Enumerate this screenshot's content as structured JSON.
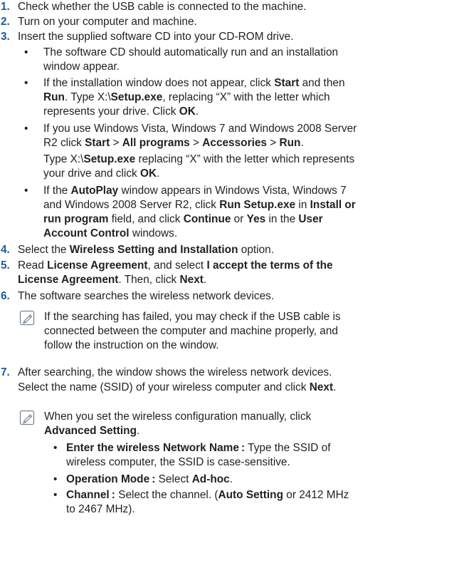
{
  "steps": [
    {
      "num": "1.",
      "lines": [
        [
          "Check whether the USB cable is connected to the machine."
        ]
      ]
    },
    {
      "num": "2.",
      "lines": [
        [
          "Turn on your computer and machine."
        ]
      ]
    },
    {
      "num": "3.",
      "lines": [
        [
          "Insert the supplied software CD into your CD-ROM drive."
        ]
      ]
    },
    {
      "num": "4.",
      "lines": [
        [
          "Select the ",
          "Wireless Setting and Installation",
          " option."
        ]
      ]
    },
    {
      "num": "5.",
      "lines": [
        [
          "Read ",
          "License Agreement",
          ", and select ",
          "I accept the terms of the"
        ],
        [
          "",
          "License Agreement",
          ". Then, click ",
          "Next",
          "."
        ]
      ]
    },
    {
      "num": "6.",
      "lines": [
        [
          "The software searches the wireless network devices."
        ]
      ]
    },
    {
      "num": "7.",
      "lines": [
        [
          "After searching, the window shows the wireless network devices."
        ],
        [
          "Select the name (SSID) of your wireless computer and click ",
          "Next",
          "."
        ]
      ]
    }
  ],
  "step3_bullets": [
    {
      "lines": [
        [
          "The software CD should automatically run and an installation"
        ],
        [
          "window appear."
        ]
      ]
    },
    {
      "lines": [
        [
          "If the installation window does not appear, click ",
          "Start",
          " and then"
        ],
        [
          "",
          "Run",
          ". Type X:\\",
          "Setup.exe",
          ", replacing “X” with the letter which"
        ],
        [
          "represents your drive. Click ",
          "OK",
          "."
        ]
      ]
    },
    {
      "lines": [
        [
          "If you use Windows Vista, Windows 7 and Windows 2008 Server"
        ],
        [
          "R2 click ",
          "Start",
          " > ",
          "All programs",
          " > ",
          "Accessories",
          " > ",
          "Run",
          "."
        ],
        [
          "Type X:\\",
          "Setup.exe",
          " replacing “X” with the letter which represents"
        ],
        [
          "your drive and click ",
          "OK",
          "."
        ]
      ]
    },
    {
      "lines": [
        [
          "If the ",
          "AutoPlay",
          " window appears in Windows Vista, Windows 7"
        ],
        [
          "and Windows 2008 Server R2, click ",
          "Run Setup.exe",
          " in ",
          "Install or"
        ],
        [
          "",
          "run program",
          " field, and click ",
          "Continue",
          " or ",
          "Yes",
          " in the ",
          "User"
        ],
        [
          "",
          "Account Control",
          " windows."
        ]
      ]
    }
  ],
  "note6": {
    "icon": "note-pencil-icon",
    "lines": [
      [
        "If the searching has failed, you may check if the USB cable is"
      ],
      [
        "connected between the computer and machine properly, and"
      ],
      [
        "follow the instruction on the window."
      ]
    ]
  },
  "note7": {
    "icon": "note-pencil-icon",
    "lines": [
      [
        "When you set the wireless configuration manually, click"
      ],
      [
        "",
        "Advanced Setting",
        "."
      ]
    ]
  },
  "note7_bullets": [
    {
      "lines": [
        [
          "",
          "Enter the wireless Network Name :",
          " Type the SSID of"
        ],
        [
          "wireless computer, the SSID is case-sensitive."
        ]
      ]
    },
    {
      "lines": [
        [
          "",
          "Operation Mode :",
          " Select ",
          "Ad-hoc",
          "."
        ]
      ]
    },
    {
      "lines": [
        [
          "",
          "Channel :",
          " Select the channel. (",
          "Auto Setting",
          " or 2412 MHz"
        ],
        [
          "to 2467 MHz)."
        ]
      ]
    }
  ],
  "bullet_char": "•",
  "colors": {
    "number": "#1f5a9a",
    "text": "#231f20",
    "icon": "#7a8591"
  }
}
